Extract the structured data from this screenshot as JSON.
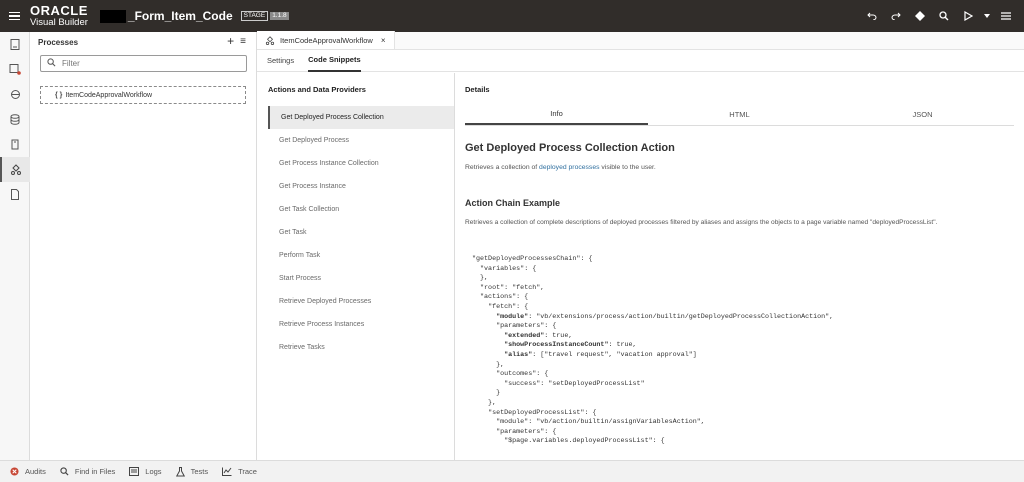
{
  "header": {
    "brand_top": "ORACLE",
    "brand_bottom": "Visual Builder",
    "app_name": "_Form_Item_Code",
    "stage": "STAGE",
    "version": "1.1.8",
    "icons": [
      "undo-icon",
      "redo-icon",
      "diamond-icon",
      "search-icon",
      "play-icon",
      "chevron-down-icon",
      "menu-icon"
    ]
  },
  "rail": {
    "icons": [
      "page-icon",
      "layout-icon",
      "web-apps-icon",
      "database-icon",
      "business-objects-icon",
      "processes-icon",
      "source-icon"
    ]
  },
  "processes": {
    "title": "Processes",
    "add": "+",
    "menu": "≡",
    "filter_placeholder": "Filter",
    "items": [
      {
        "braces": "{ }",
        "label": "ItemCodeApprovalWorkflow"
      }
    ]
  },
  "editor": {
    "tab_label": "ItemCodeApprovalWorkflow",
    "tab_close": "×",
    "subtabs": [
      "Settings",
      "Code Snippets"
    ],
    "actions_title": "Actions and Data Providers",
    "actions": [
      "Get Deployed Process Collection",
      "Get Deployed Process",
      "Get Process Instance Collection",
      "Get Process Instance",
      "Get Task Collection",
      "Get Task",
      "Perform Task",
      "Start Process",
      "Retrieve Deployed Processes",
      "Retrieve Process Instances",
      "Retrieve Tasks"
    ],
    "details_title": "Details",
    "info_tabs": [
      "Info",
      "HTML",
      "JSON"
    ],
    "heading": "Get Deployed Process Collection Action",
    "desc1_pre": "Retrieves a collection of ",
    "desc1_link": "deployed processes",
    "desc1_post": " visible to the user.",
    "subheading": "Action Chain Example",
    "desc2": "Retrieves a collection of complete descriptions of deployed processes filtered by aliases and assigns the objects to a page variable named \"deployedProcessList\".",
    "code": [
      "\"getDeployedProcessesChain\": {",
      "  \"variables\": {",
      "  },",
      "  \"root\": \"fetch\",",
      "  \"actions\": {",
      "    \"fetch\": {",
      "      \"module\": \"vb/extensions/process/action/builtin/getDeployedProcessCollectionAction\",",
      "      \"parameters\": {",
      "        \"extended\": true,",
      "        \"showProcessInstanceCount\": true,",
      "        \"alias\": [\"travel request\", \"vacation approval\"]",
      "      },",
      "      \"outcomes\": {",
      "        \"success\": \"setDeployedProcessList\"",
      "      }",
      "    },",
      "    \"setDeployedProcessList\": {",
      "      \"module\": \"vb/action/builtin/assignVariablesAction\",",
      "      \"parameters\": {",
      "        \"$page.variables.deployedProcessList\": {"
    ]
  },
  "bottom": {
    "items": [
      {
        "label": "Audits",
        "icon": "error-icon"
      },
      {
        "label": "Find in Files",
        "icon": "search-icon"
      },
      {
        "label": "Logs",
        "icon": "logs-icon"
      },
      {
        "label": "Tests",
        "icon": "tests-icon"
      },
      {
        "label": "Trace",
        "icon": "trace-icon"
      }
    ]
  }
}
